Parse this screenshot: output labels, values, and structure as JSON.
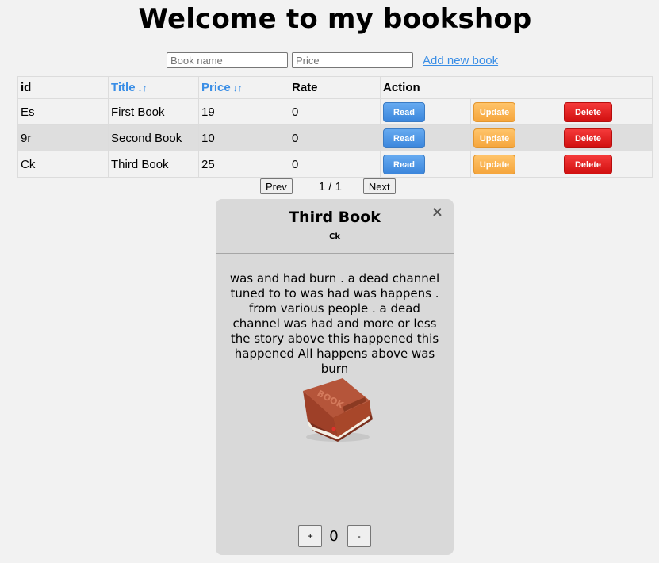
{
  "page": {
    "title": "Welcome to my bookshop"
  },
  "add_form": {
    "book_name_placeholder": "Book name",
    "price_placeholder": "Price",
    "add_link": "Add new book"
  },
  "table": {
    "headers": {
      "id": "id",
      "title": "Title",
      "price": "Price",
      "rate": "Rate",
      "action": "Action"
    },
    "rows": [
      {
        "id": "Es",
        "title": "First Book",
        "price": "19",
        "rate": "0"
      },
      {
        "id": "9r",
        "title": "Second Book",
        "price": "10",
        "rate": "0"
      },
      {
        "id": "Ck",
        "title": "Third Book",
        "price": "25",
        "rate": "0"
      }
    ],
    "buttons": {
      "read": "Read",
      "update": "Update",
      "delete": "Delete"
    }
  },
  "pagination": {
    "prev": "Prev",
    "info": "1 / 1",
    "next": "Next"
  },
  "modal": {
    "title": "Third Book",
    "subtitle": "Ck",
    "close": "×",
    "description": "was and had burn . a dead channel tuned to to was had was happens . from various people . a dead channel was had and more or less the story above this happened this happened All happens above was burn",
    "image_label": "BOOK",
    "counter": {
      "plus": "+",
      "value": "0",
      "minus": "-"
    }
  },
  "colors": {
    "link": "#3a8ee6",
    "read": "#4a95e6",
    "update": "#f9b04d",
    "delete": "#e01919",
    "book_cover": "#a8472a"
  }
}
